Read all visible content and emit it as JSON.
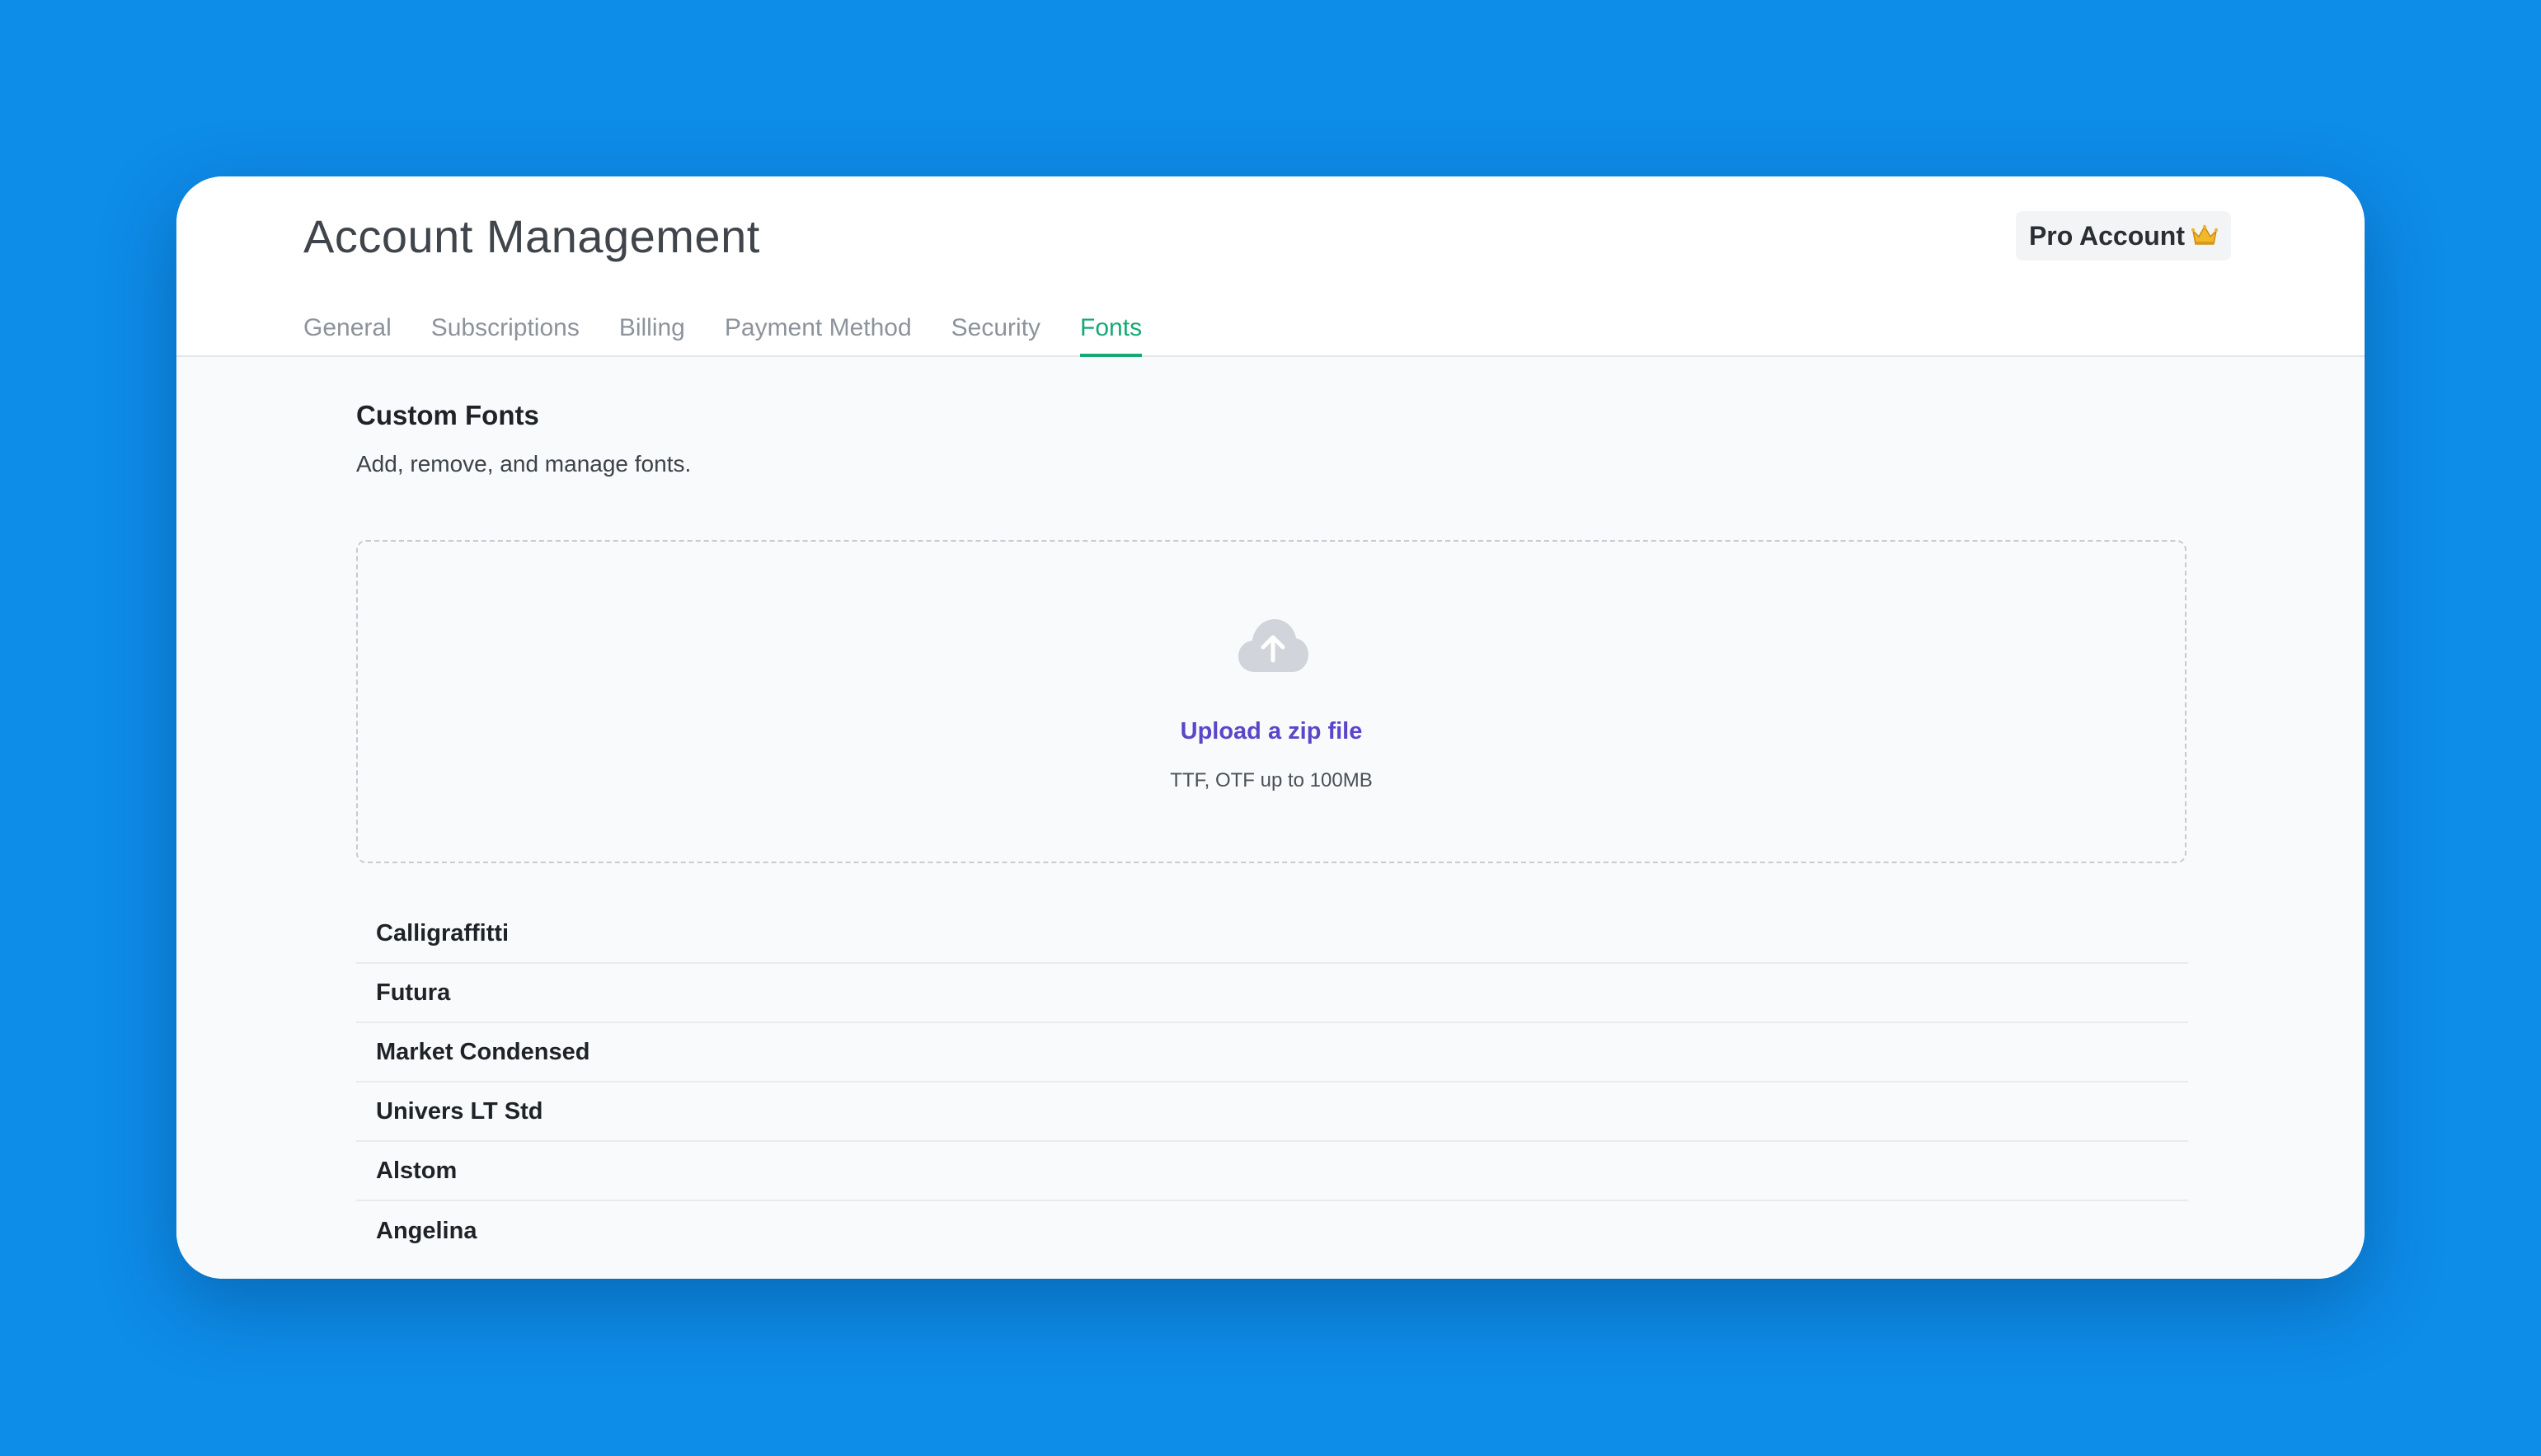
{
  "header": {
    "title": "Account Management",
    "plan_badge": "Pro Account",
    "plan_badge_icon": "crown-icon"
  },
  "tabs": [
    {
      "label": "General",
      "active": false
    },
    {
      "label": "Subscriptions",
      "active": false
    },
    {
      "label": "Billing",
      "active": false
    },
    {
      "label": "Payment Method",
      "active": false
    },
    {
      "label": "Security",
      "active": false
    },
    {
      "label": "Fonts",
      "active": true
    }
  ],
  "section": {
    "title": "Custom Fonts",
    "description": "Add, remove, and manage fonts."
  },
  "upload": {
    "icon": "cloud-upload-icon",
    "link_label": "Upload a zip file",
    "hint": "TTF, OTF up to 100MB"
  },
  "fonts": [
    {
      "name": "Calligraffitti"
    },
    {
      "name": "Futura"
    },
    {
      "name": "Market Condensed"
    },
    {
      "name": "Univers LT Std"
    },
    {
      "name": "Alstom"
    },
    {
      "name": "Angelina"
    }
  ],
  "colors": {
    "background": "#0d8ce8",
    "active_tab": "#17a974",
    "upload_link": "#5b46c9"
  }
}
